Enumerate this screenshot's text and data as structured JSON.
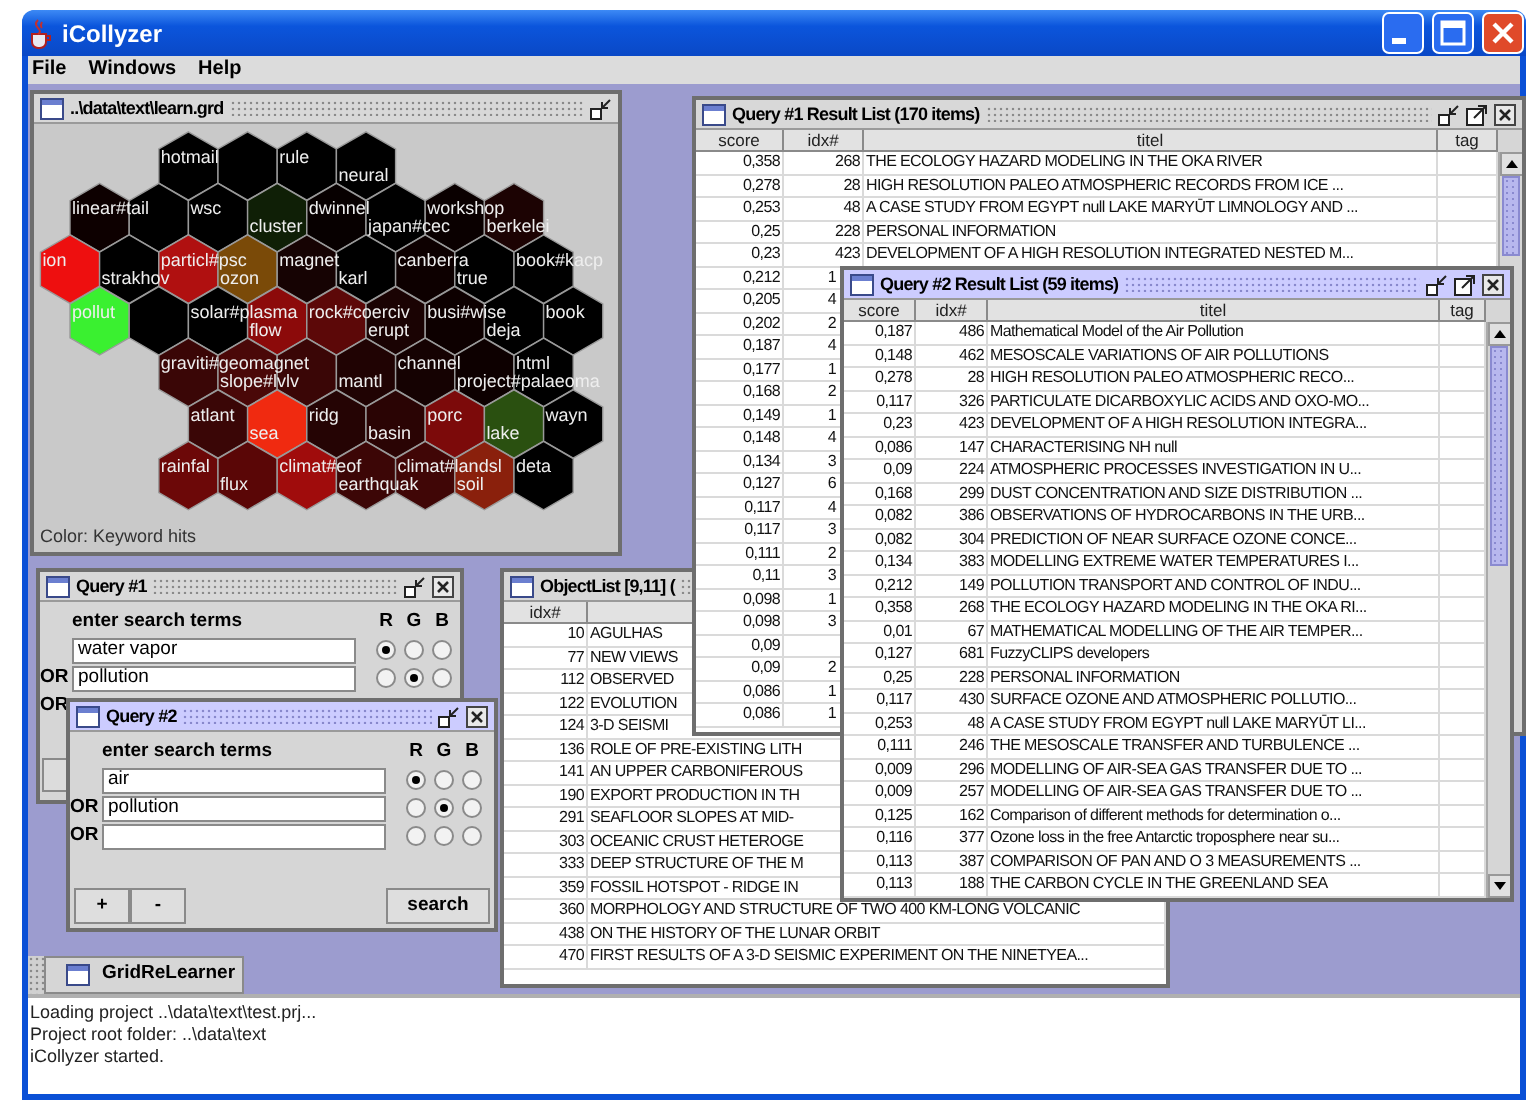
{
  "window": {
    "title": "iCollyzer"
  },
  "menu": [
    "File",
    "Windows",
    "Help"
  ],
  "grid_window": {
    "title": "..\\data\\text\\learn.grd",
    "active": false,
    "legend": "Color: Keyword hits",
    "map": {
      "rows": [
        {
          "cells": [
            {
              "color": "#000000",
              "label": "hotmail"
            },
            {
              "color": "#000000"
            },
            {
              "color": "#000000",
              "label": "rule"
            },
            {
              "color": "#000000",
              "label": "neural"
            }
          ]
        },
        {
          "cells": [
            {
              "color": "#0d0000",
              "label": "linear#tail"
            },
            {
              "color": "#000000"
            },
            {
              "color": "#000000",
              "label": "wsc"
            },
            {
              "color": "#0f1f06",
              "label": "cluster"
            },
            {
              "color": "#070000",
              "label": "dwinnel"
            },
            {
              "color": "#000000",
              "label": "japan#cec"
            },
            {
              "color": "#0a0000",
              "label": "workshop"
            },
            {
              "color": "#1c0303",
              "label": "berkelei"
            }
          ]
        },
        {
          "cells": [
            {
              "color": "#ee0f0f",
              "label": "ion"
            },
            {
              "color": "#000000",
              "label": "strakhov"
            },
            {
              "color": "#b01010",
              "label": "particl#psc"
            },
            {
              "color": "#7a4a08",
              "label": "ozon"
            },
            {
              "color": "#160303",
              "label": "magnet"
            },
            {
              "color": "#000000",
              "label": "karl"
            },
            {
              "color": "#0d0000",
              "label": "canberra"
            },
            {
              "color": "#000000",
              "label": "true"
            },
            {
              "color": "#000000",
              "label": "book#kacp"
            }
          ]
        },
        {
          "cells": [
            {
              "color": "#3af030",
              "label": "pollut"
            },
            {
              "color": "#000000"
            },
            {
              "color": "#000000",
              "label": "solar#plasma"
            },
            {
              "color": "#8c0a0a",
              "label": "flow"
            },
            {
              "color": "#5c0808",
              "label": "rock#coerciv"
            },
            {
              "color": "#1a0303",
              "label": "erupt"
            },
            {
              "color": "#0d0000",
              "label": "busi#wise"
            },
            {
              "color": "#000000",
              "label": "deja"
            },
            {
              "color": "#000000",
              "label": "book"
            }
          ]
        },
        {
          "cells": [
            {
              "color": "#3a0606",
              "label": "graviti#geomagnet"
            },
            {
              "color": "#4a0808",
              "label": "slope#lvlv"
            },
            {
              "color": "#3a0606"
            },
            {
              "color": "#200303",
              "label": "mantl"
            },
            {
              "color": "#150202",
              "label": "channel"
            },
            {
              "color": "#0d0000",
              "label": "project#palaeoma"
            },
            {
              "color": "#000000",
              "label": "html"
            }
          ]
        },
        {
          "cells": [
            {
              "color": "#3a0606",
              "label": "atlant"
            },
            {
              "color": "#f02a10",
              "label": "sea"
            },
            {
              "color": "#250404",
              "label": "ridg"
            },
            {
              "color": "#2a0404",
              "label": "basin"
            },
            {
              "color": "#7c0a0a",
              "label": "porc"
            },
            {
              "color": "#2a5010",
              "label": "lake"
            },
            {
              "color": "#000000",
              "label": "wayn"
            }
          ]
        },
        {
          "cells": [
            {
              "color": "#6c0808",
              "label": "rainfal"
            },
            {
              "color": "#5a0606",
              "label": "flux"
            },
            {
              "color": "#a00c0c",
              "label": "climat#eof"
            },
            {
              "color": "#3c0606",
              "label": "earthquak"
            },
            {
              "color": "#400606",
              "label": "climat#landsl"
            },
            {
              "color": "#8a200c",
              "label": "soil"
            },
            {
              "color": "#000000",
              "label": "deta"
            }
          ]
        }
      ]
    }
  },
  "query_1": {
    "title": "Query #1",
    "active": false,
    "heading": "enter search terms",
    "channels": [
      "R",
      "G",
      "B"
    ],
    "terms": [
      {
        "kind": "term",
        "value": "water vapor",
        "radios": [
          {
            "selected": true
          },
          {
            "selected": false
          },
          {
            "selected": false
          }
        ]
      },
      {
        "kind": "term",
        "prefix": "OR",
        "value": "pollution",
        "radios": [
          {
            "selected": false
          },
          {
            "selected": true
          },
          {
            "selected": false
          }
        ]
      },
      {
        "kind": "covered",
        "prefix": "OR"
      }
    ]
  },
  "object_list": {
    "title": "ObjectList [9,11] (",
    "active": false,
    "columns": [
      "idx#"
    ],
    "rows": [
      {
        "idx": "10",
        "titel": "AGULHAS"
      },
      {
        "idx": "77",
        "titel": "NEW VIEWS"
      },
      {
        "idx": "112",
        "titel": "OBSERVED"
      },
      {
        "idx": "122",
        "titel": "EVOLUTION"
      },
      {
        "idx": "124",
        "titel": "3-D SEISMI"
      },
      {
        "idx": "136",
        "titel": "ROLE OF PRE-EXISTING LITH"
      },
      {
        "idx": "141",
        "titel": "AN UPPER CARBONIFEROUS"
      },
      {
        "idx": "190",
        "titel": "EXPORT PRODUCTION IN TH"
      },
      {
        "idx": "291",
        "titel": "SEAFLOOR SLOPES AT MID-"
      },
      {
        "idx": "303",
        "titel": "OCEANIC CRUST HETEROGE"
      },
      {
        "idx": "333",
        "titel": "DEEP STRUCTURE OF THE M"
      },
      {
        "idx": "359",
        "titel": "FOSSIL HOTSPOT - RIDGE IN"
      },
      {
        "idx": "360",
        "titel": "MORPHOLOGY AND STRUCTURE OF TWO 400 KM-LONG VOLCANIC"
      },
      {
        "idx": "438",
        "titel": "ON THE HISTORY OF THE LUNAR ORBIT"
      },
      {
        "idx": "470",
        "titel": "FIRST RESULTS OF A 3-D SEISMIC EXPERIMENT ON THE NINETYEA..."
      }
    ]
  },
  "results_1": {
    "title": "Query #1 Result List (170 items)",
    "active": false,
    "columns": [
      "score",
      "idx#",
      "titel",
      "tag"
    ],
    "rows": [
      {
        "score": "0,358",
        "idx": "268",
        "titel": "THE ECOLOGY HAZARD MODELING IN THE OKA RIVER"
      },
      {
        "score": "0,278",
        "idx": "28",
        "titel": "HIGH RESOLUTION PALEO ATMOSPHERIC RECORDS FROM ICE ..."
      },
      {
        "score": "0,253",
        "idx": "48",
        "titel": "A CASE STUDY FROM EGYPT null LAKE MARYŪT LIMNOLOGY AND ..."
      },
      {
        "score": "0,25",
        "idx": "228",
        "titel": "PERSONAL INFORMATION"
      },
      {
        "score": "0,23",
        "idx": "423",
        "titel": "DEVELOPMENT OF A HIGH RESOLUTION INTEGRATED NESTED M..."
      },
      {
        "score": "0,212",
        "idx": "1"
      },
      {
        "score": "0,205",
        "idx": "4"
      },
      {
        "score": "0,202",
        "idx": "2"
      },
      {
        "score": "0,187",
        "idx": "4"
      },
      {
        "score": "0,177",
        "idx": "1"
      },
      {
        "score": "0,168",
        "idx": "2"
      },
      {
        "score": "0,149",
        "idx": "1"
      },
      {
        "score": "0,148",
        "idx": "4"
      },
      {
        "score": "0,134",
        "idx": "3"
      },
      {
        "score": "0,127",
        "idx": "6"
      },
      {
        "score": "0,117",
        "idx": "4"
      },
      {
        "score": "0,117",
        "idx": "3"
      },
      {
        "score": "0,111",
        "idx": "2"
      },
      {
        "score": "0,11",
        "idx": "3"
      },
      {
        "score": "0,098",
        "idx": "1"
      },
      {
        "score": "0,098",
        "idx": "3"
      },
      {
        "score": "0,09"
      },
      {
        "score": "0,09",
        "idx": "2"
      },
      {
        "score": "0,086",
        "idx": "1"
      },
      {
        "score": "0,086",
        "idx": "1"
      }
    ]
  },
  "results_2": {
    "title": "Query #2 Result List (59 items)",
    "active": true,
    "columns": [
      "score",
      "idx#",
      "titel",
      "tag"
    ],
    "rows": [
      {
        "score": "0,187",
        "idx": "486",
        "titel": "Mathematical Model of the Air Pollution"
      },
      {
        "score": "0,148",
        "idx": "462",
        "titel": "MESOSCALE VARIATIONS OF AIR POLLUTIONS"
      },
      {
        "score": "0,278",
        "idx": "28",
        "titel": "HIGH RESOLUTION PALEO ATMOSPHERIC RECO..."
      },
      {
        "score": "0,117",
        "idx": "326",
        "titel": "PARTICULATE DICARBOXYLIC ACIDS AND OXO-MO..."
      },
      {
        "score": "0,23",
        "idx": "423",
        "titel": "DEVELOPMENT OF A HIGH RESOLUTION INTEGRA..."
      },
      {
        "score": "0,086",
        "idx": "147",
        "titel": "CHARACTERISING NH null"
      },
      {
        "score": "0,09",
        "idx": "224",
        "titel": "ATMOSPHERIC PROCESSES INVESTIGATION IN U..."
      },
      {
        "score": "0,168",
        "idx": "299",
        "titel": "DUST CONCENTRATION AND SIZE DISTRIBUTION ..."
      },
      {
        "score": "0,082",
        "idx": "386",
        "titel": "OBSERVATIONS OF HYDROCARBONS IN THE URB..."
      },
      {
        "score": "0,082",
        "idx": "304",
        "titel": "PREDICTION OF NEAR SURFACE OZONE CONCE..."
      },
      {
        "score": "0,134",
        "idx": "383",
        "titel": "MODELLING EXTREME WATER TEMPERATURES I..."
      },
      {
        "score": "0,212",
        "idx": "149",
        "titel": "POLLUTION TRANSPORT AND CONTROL OF INDU..."
      },
      {
        "score": "0,358",
        "idx": "268",
        "titel": "THE ECOLOGY HAZARD MODELING IN THE OKA RI..."
      },
      {
        "score": "0,01",
        "idx": "67",
        "titel": "MATHEMATICAL MODELLING OF THE AIR TEMPER..."
      },
      {
        "score": "0,127",
        "idx": "681",
        "titel": "FuzzyCLIPS developers"
      },
      {
        "score": "0,25",
        "idx": "228",
        "titel": "PERSONAL INFORMATION"
      },
      {
        "score": "0,117",
        "idx": "430",
        "titel": "SURFACE OZONE AND ATMOSPHERIC POLLUTIO..."
      },
      {
        "score": "0,253",
        "idx": "48",
        "titel": "A CASE STUDY FROM EGYPT null LAKE MARYŪT LI..."
      },
      {
        "score": "0,111",
        "idx": "246",
        "titel": "THE MESOSCALE TRANSFER AND TURBULENCE ..."
      },
      {
        "score": "0,009",
        "idx": "296",
        "titel": "MODELLING OF AIR-SEA GAS TRANSFER DUE TO ..."
      },
      {
        "score": "0,009",
        "idx": "257",
        "titel": "MODELLING OF AIR-SEA GAS TRANSFER DUE TO ..."
      },
      {
        "score": "0,125",
        "idx": "162",
        "titel": "Comparison of different methods for determination o..."
      },
      {
        "score": "0,116",
        "idx": "377",
        "titel": "Ozone loss in the free Antarctic troposphere near su..."
      },
      {
        "score": "0,113",
        "idx": "387",
        "titel": "COMPARISON OF PAN AND O 3 MEASUREMENTS ..."
      },
      {
        "score": "0,113",
        "idx": "188",
        "titel": "THE CARBON CYCLE IN THE GREENLAND SEA"
      }
    ]
  },
  "query_2": {
    "title": "Query #2",
    "active": true,
    "heading": "enter search terms",
    "channels": [
      "R",
      "G",
      "B"
    ],
    "terms": [
      {
        "kind": "term",
        "value": "air",
        "radios": [
          {
            "selected": true
          },
          {
            "selected": false
          },
          {
            "selected": false
          }
        ]
      },
      {
        "kind": "term",
        "prefix": "OR",
        "value": "pollution",
        "radios": [
          {
            "selected": false
          },
          {
            "selected": true
          },
          {
            "selected": false
          }
        ]
      },
      {
        "kind": "term",
        "prefix": "OR",
        "radios": [
          {
            "selected": false
          },
          {
            "selected": false
          },
          {
            "selected": false
          }
        ]
      }
    ],
    "buttons": [
      "+",
      "-",
      "search"
    ]
  },
  "minimized": [
    {
      "title": "GridReLearner"
    }
  ],
  "log": [
    "Loading project ..\\data\\text\\test.prj...",
    "Project root folder: ..\\data\\text",
    "iCollyzer started."
  ]
}
